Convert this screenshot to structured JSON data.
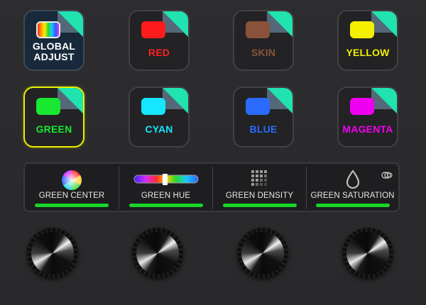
{
  "colors": {
    "active_border": "#e6f000",
    "level_bar": "#19d62a",
    "corner_tab": "#21e3b0"
  },
  "color_buttons": [
    {
      "label": "GLOBAL ADJUST",
      "label_lines": [
        "GLOBAL",
        "ADJUST"
      ],
      "swatch": "rainbow",
      "label_color": "#ffffff"
    },
    {
      "label": "RED",
      "swatch": "#ff1b1b",
      "label_color": "#ff2020"
    },
    {
      "label": "SKIN",
      "swatch": "#8a5339",
      "label_color": "#8a5339"
    },
    {
      "label": "YELLOW",
      "swatch": "#f4f000",
      "label_color": "#f0ee00"
    },
    {
      "label": "GREEN",
      "swatch": "#18e830",
      "label_color": "#18e830",
      "selected": true
    },
    {
      "label": "CYAN",
      "swatch": "#16e6ff",
      "label_color": "#16e6ff"
    },
    {
      "label": "BLUE",
      "swatch": "#2b6bff",
      "label_color": "#2b6bff"
    },
    {
      "label": "MAGENTA",
      "swatch": "#f000f0",
      "label_color": "#f000f0"
    }
  ],
  "parameters": [
    {
      "label": "GREEN CENTER",
      "icon": "color-wheel-icon",
      "level": 1.0
    },
    {
      "label": "GREEN HUE",
      "icon": "hue-slider-icon",
      "level": 1.0
    },
    {
      "label": "GREEN DENSITY",
      "icon": "density-grid-icon",
      "level": 1.0
    },
    {
      "label": "GREEN SATURATION",
      "icon": "saturation-drop-icon",
      "level": 1.0
    }
  ],
  "knobs": [
    {
      "name": "knob-1"
    },
    {
      "name": "knob-2"
    },
    {
      "name": "knob-3"
    },
    {
      "name": "knob-4"
    }
  ]
}
